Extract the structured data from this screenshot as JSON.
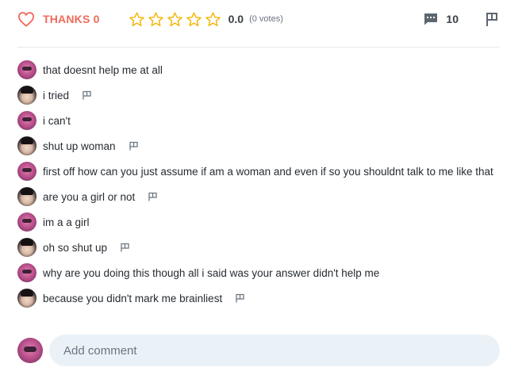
{
  "toolbar": {
    "thanks_label": "THANKS 0",
    "rating_value": "0.0",
    "votes_label": "(0 votes)",
    "stars": 0,
    "comment_count": "10",
    "accent_color": "#ef6a5a",
    "star_color": "#f5b400"
  },
  "comments": [
    {
      "text": "that doesnt help me at all",
      "avatar": "pink",
      "report": false
    },
    {
      "text": "i tried",
      "avatar": "dark",
      "report": true
    },
    {
      "text": "i can't",
      "avatar": "pink",
      "report": false
    },
    {
      "text": "shut up woman",
      "avatar": "dark",
      "report": true
    },
    {
      "text": "first off how can you just assume if am a woman and even if so you shouldnt talk to me like that",
      "avatar": "pink",
      "report": false
    },
    {
      "text": "are you a girl or not",
      "avatar": "dark",
      "report": true
    },
    {
      "text": "im a a girl",
      "avatar": "pink",
      "report": false
    },
    {
      "text": "oh so shut up",
      "avatar": "dark",
      "report": true
    },
    {
      "text": "why are you doing this though all i said was your answer didn't help me",
      "avatar": "pink",
      "report": false
    },
    {
      "text": "because you didn't mark me brainliest",
      "avatar": "dark",
      "report": true
    }
  ],
  "add_comment": {
    "placeholder": "Add comment"
  }
}
